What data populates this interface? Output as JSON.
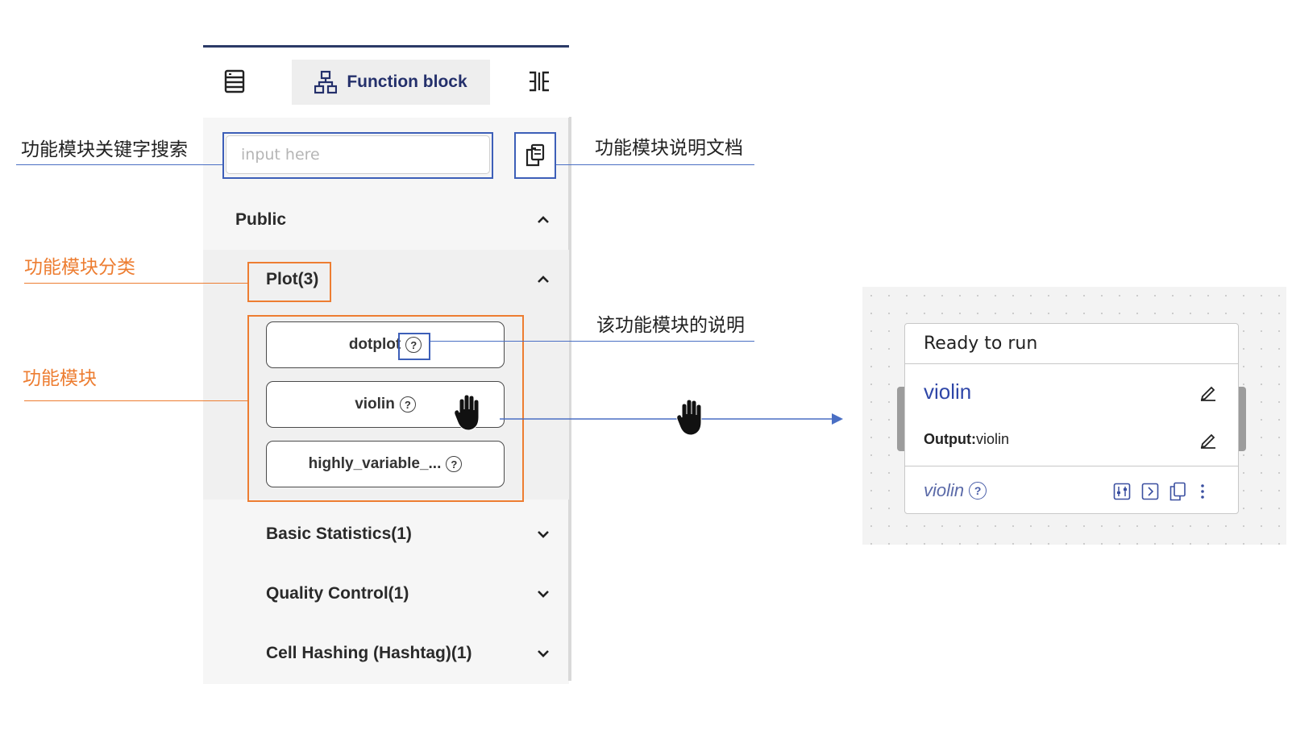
{
  "tabs": {
    "active_label": "Function block"
  },
  "search": {
    "placeholder": "input here"
  },
  "categories": {
    "public": "Public",
    "plot": "Plot(3)",
    "basic": "Basic Statistics(1)",
    "qc": "Quality Control(1)",
    "hash": "Cell Hashing (Hashtag)(1)"
  },
  "blocks": [
    {
      "label": "dotplot"
    },
    {
      "label": "violin"
    },
    {
      "label": "highly_variable_..."
    }
  ],
  "annotations": {
    "search": "功能模块关键字搜索",
    "doc": "功能模块说明文档",
    "category": "功能模块分类",
    "help": "该功能模块的说明",
    "block": "功能模块"
  },
  "node": {
    "status": "Ready to run",
    "title": "violin",
    "output_label": "Output:",
    "output_value": "violin",
    "footer_name": "violin"
  },
  "colors": {
    "accent_blue": "#3d5fb8",
    "annotation_orange": "#ed7d31",
    "node_title": "#2f47a8"
  }
}
